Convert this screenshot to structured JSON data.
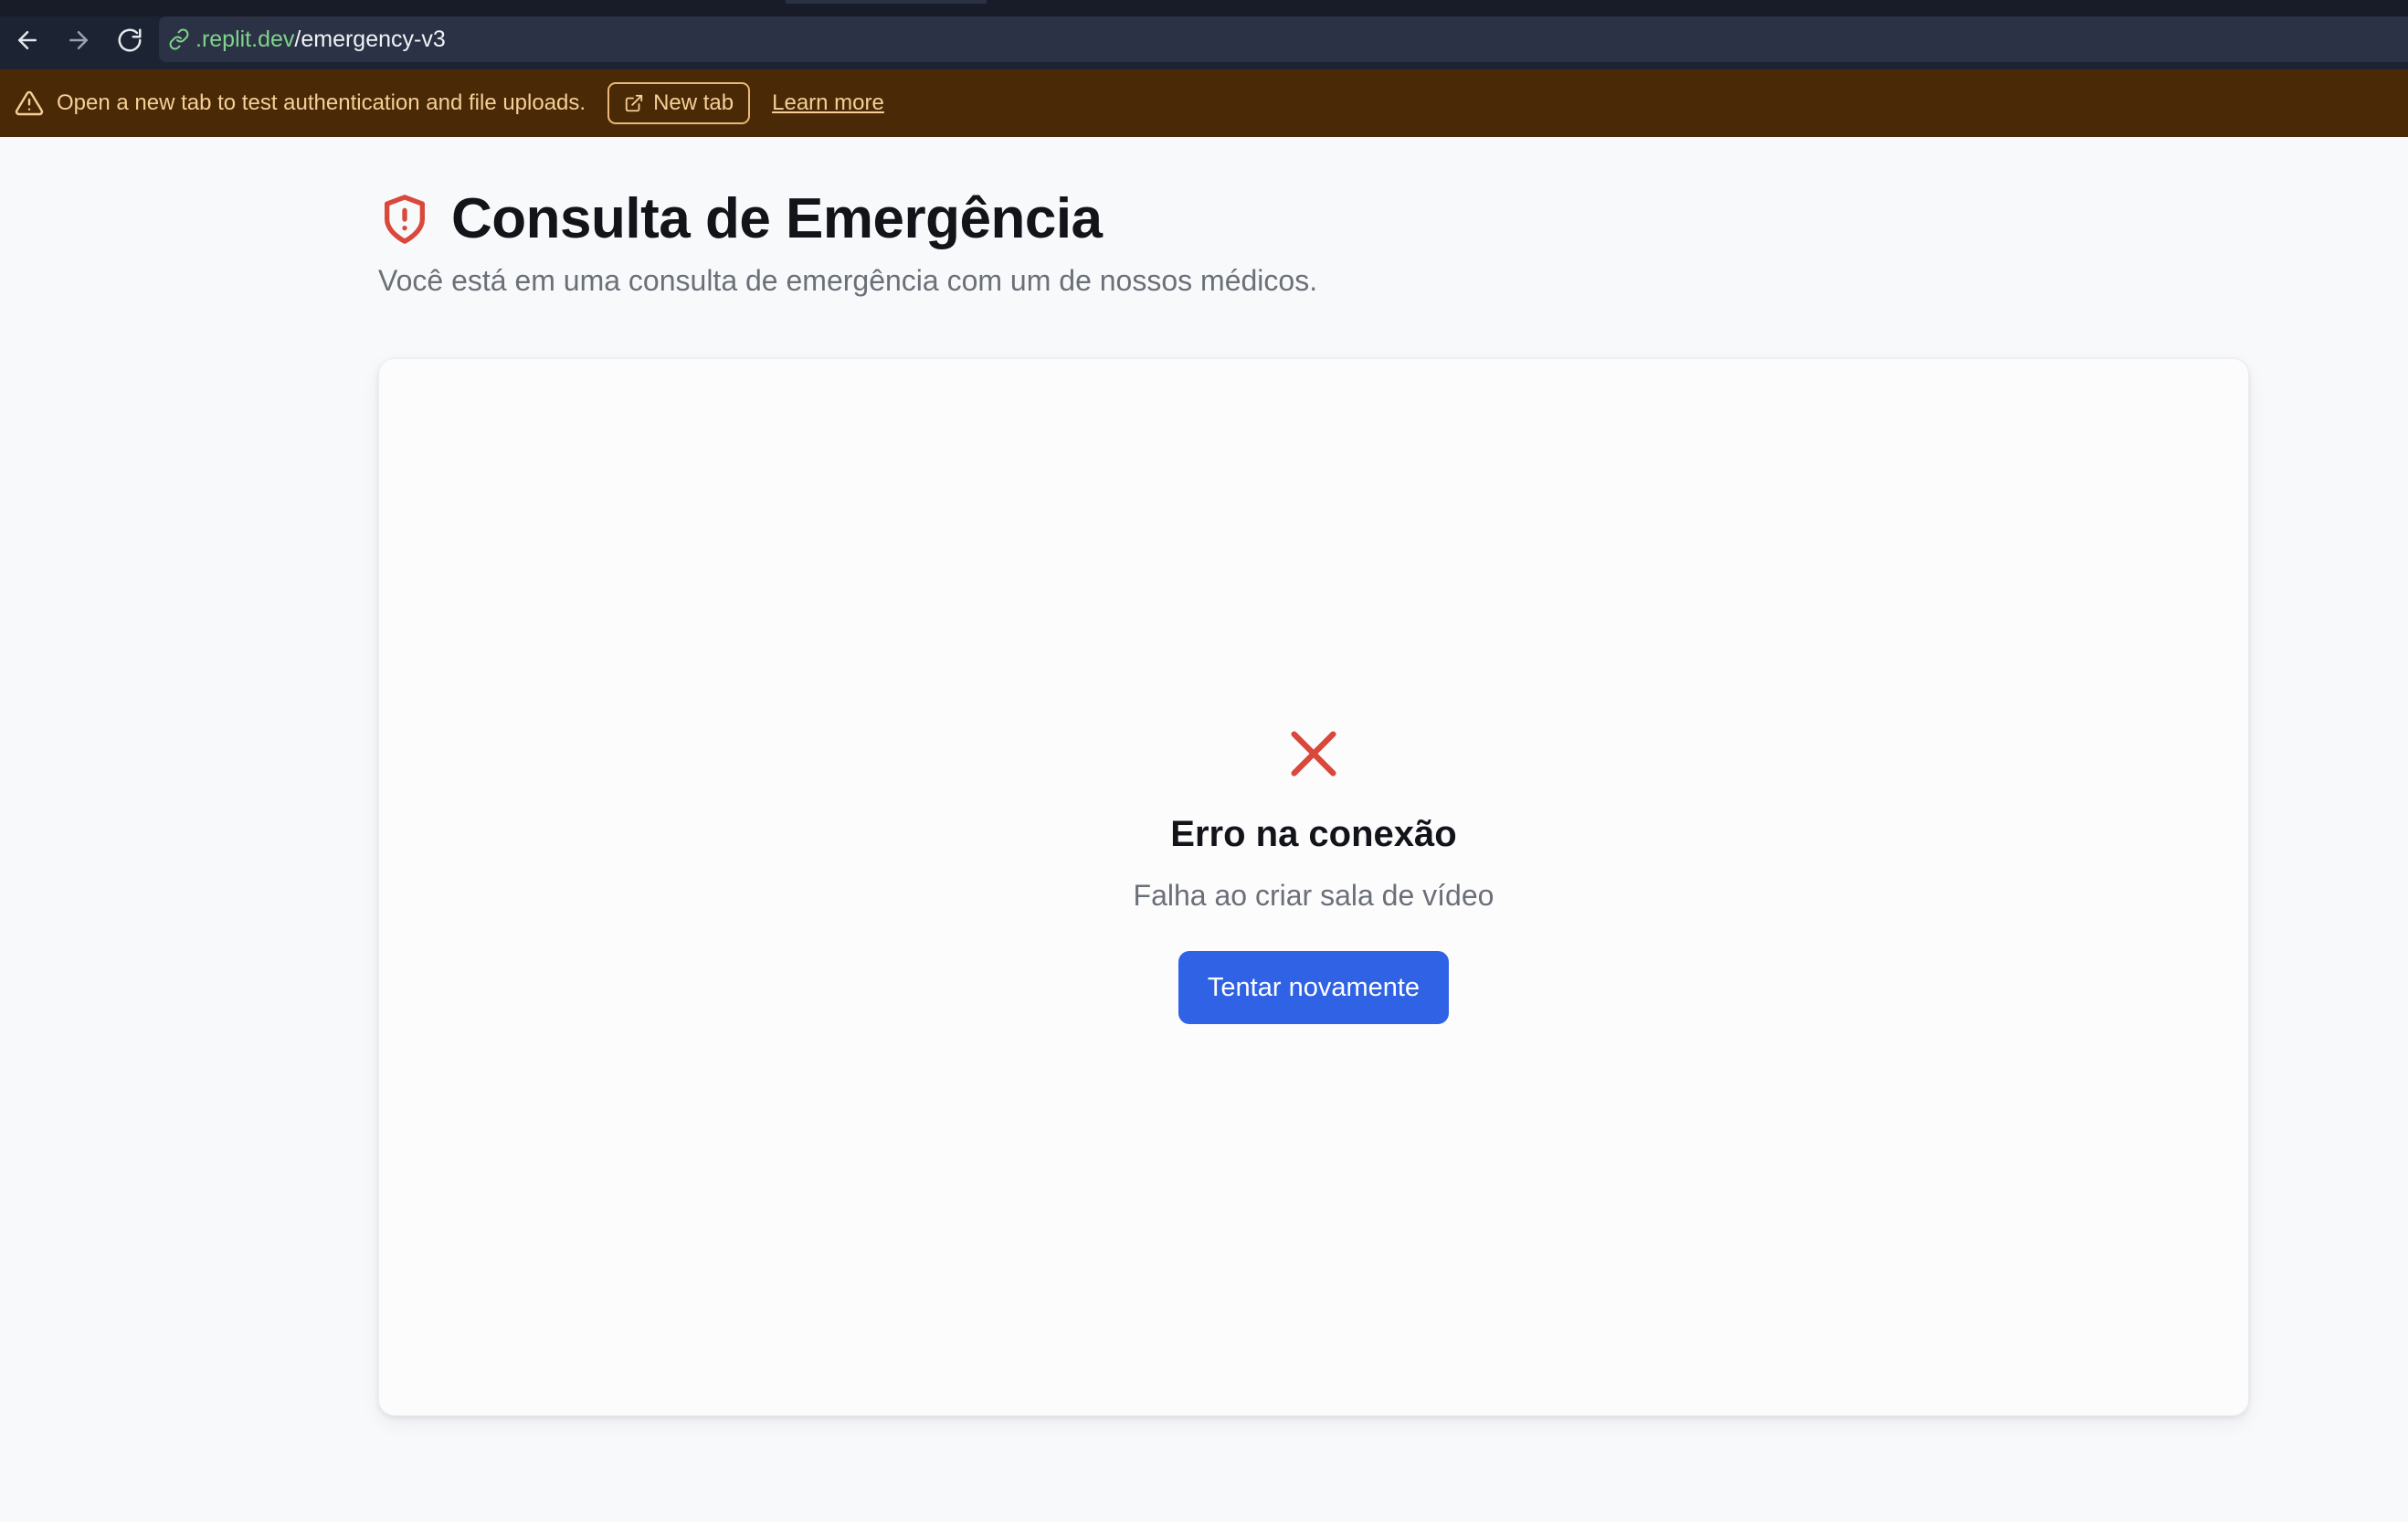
{
  "browser": {
    "url_domain": ".replit.dev",
    "url_path": "/emergency-v3",
    "icons": {
      "back": "arrow-left-icon",
      "forward": "arrow-right-icon",
      "reload": "reload-icon",
      "link": "link-icon"
    }
  },
  "banner": {
    "message": "Open a new tab to test authentication and file uploads.",
    "new_tab_label": "New tab",
    "learn_more_label": "Learn more",
    "icons": {
      "warning": "warning-icon",
      "external": "external-link-icon"
    },
    "background": "#4a2a06",
    "text_color": "#f5cf97"
  },
  "page": {
    "title": "Consulta de Emergência",
    "subtitle": "Você está em uma consulta de emergência com um de nossos médicos.",
    "title_icon": "shield-alert-icon",
    "accent_color": "#d9483b"
  },
  "error": {
    "icon": "x-icon",
    "title": "Erro na conexão",
    "message": "Falha ao criar sala de vídeo",
    "retry_label": "Tentar novamente",
    "button_color": "#2f62e4"
  }
}
